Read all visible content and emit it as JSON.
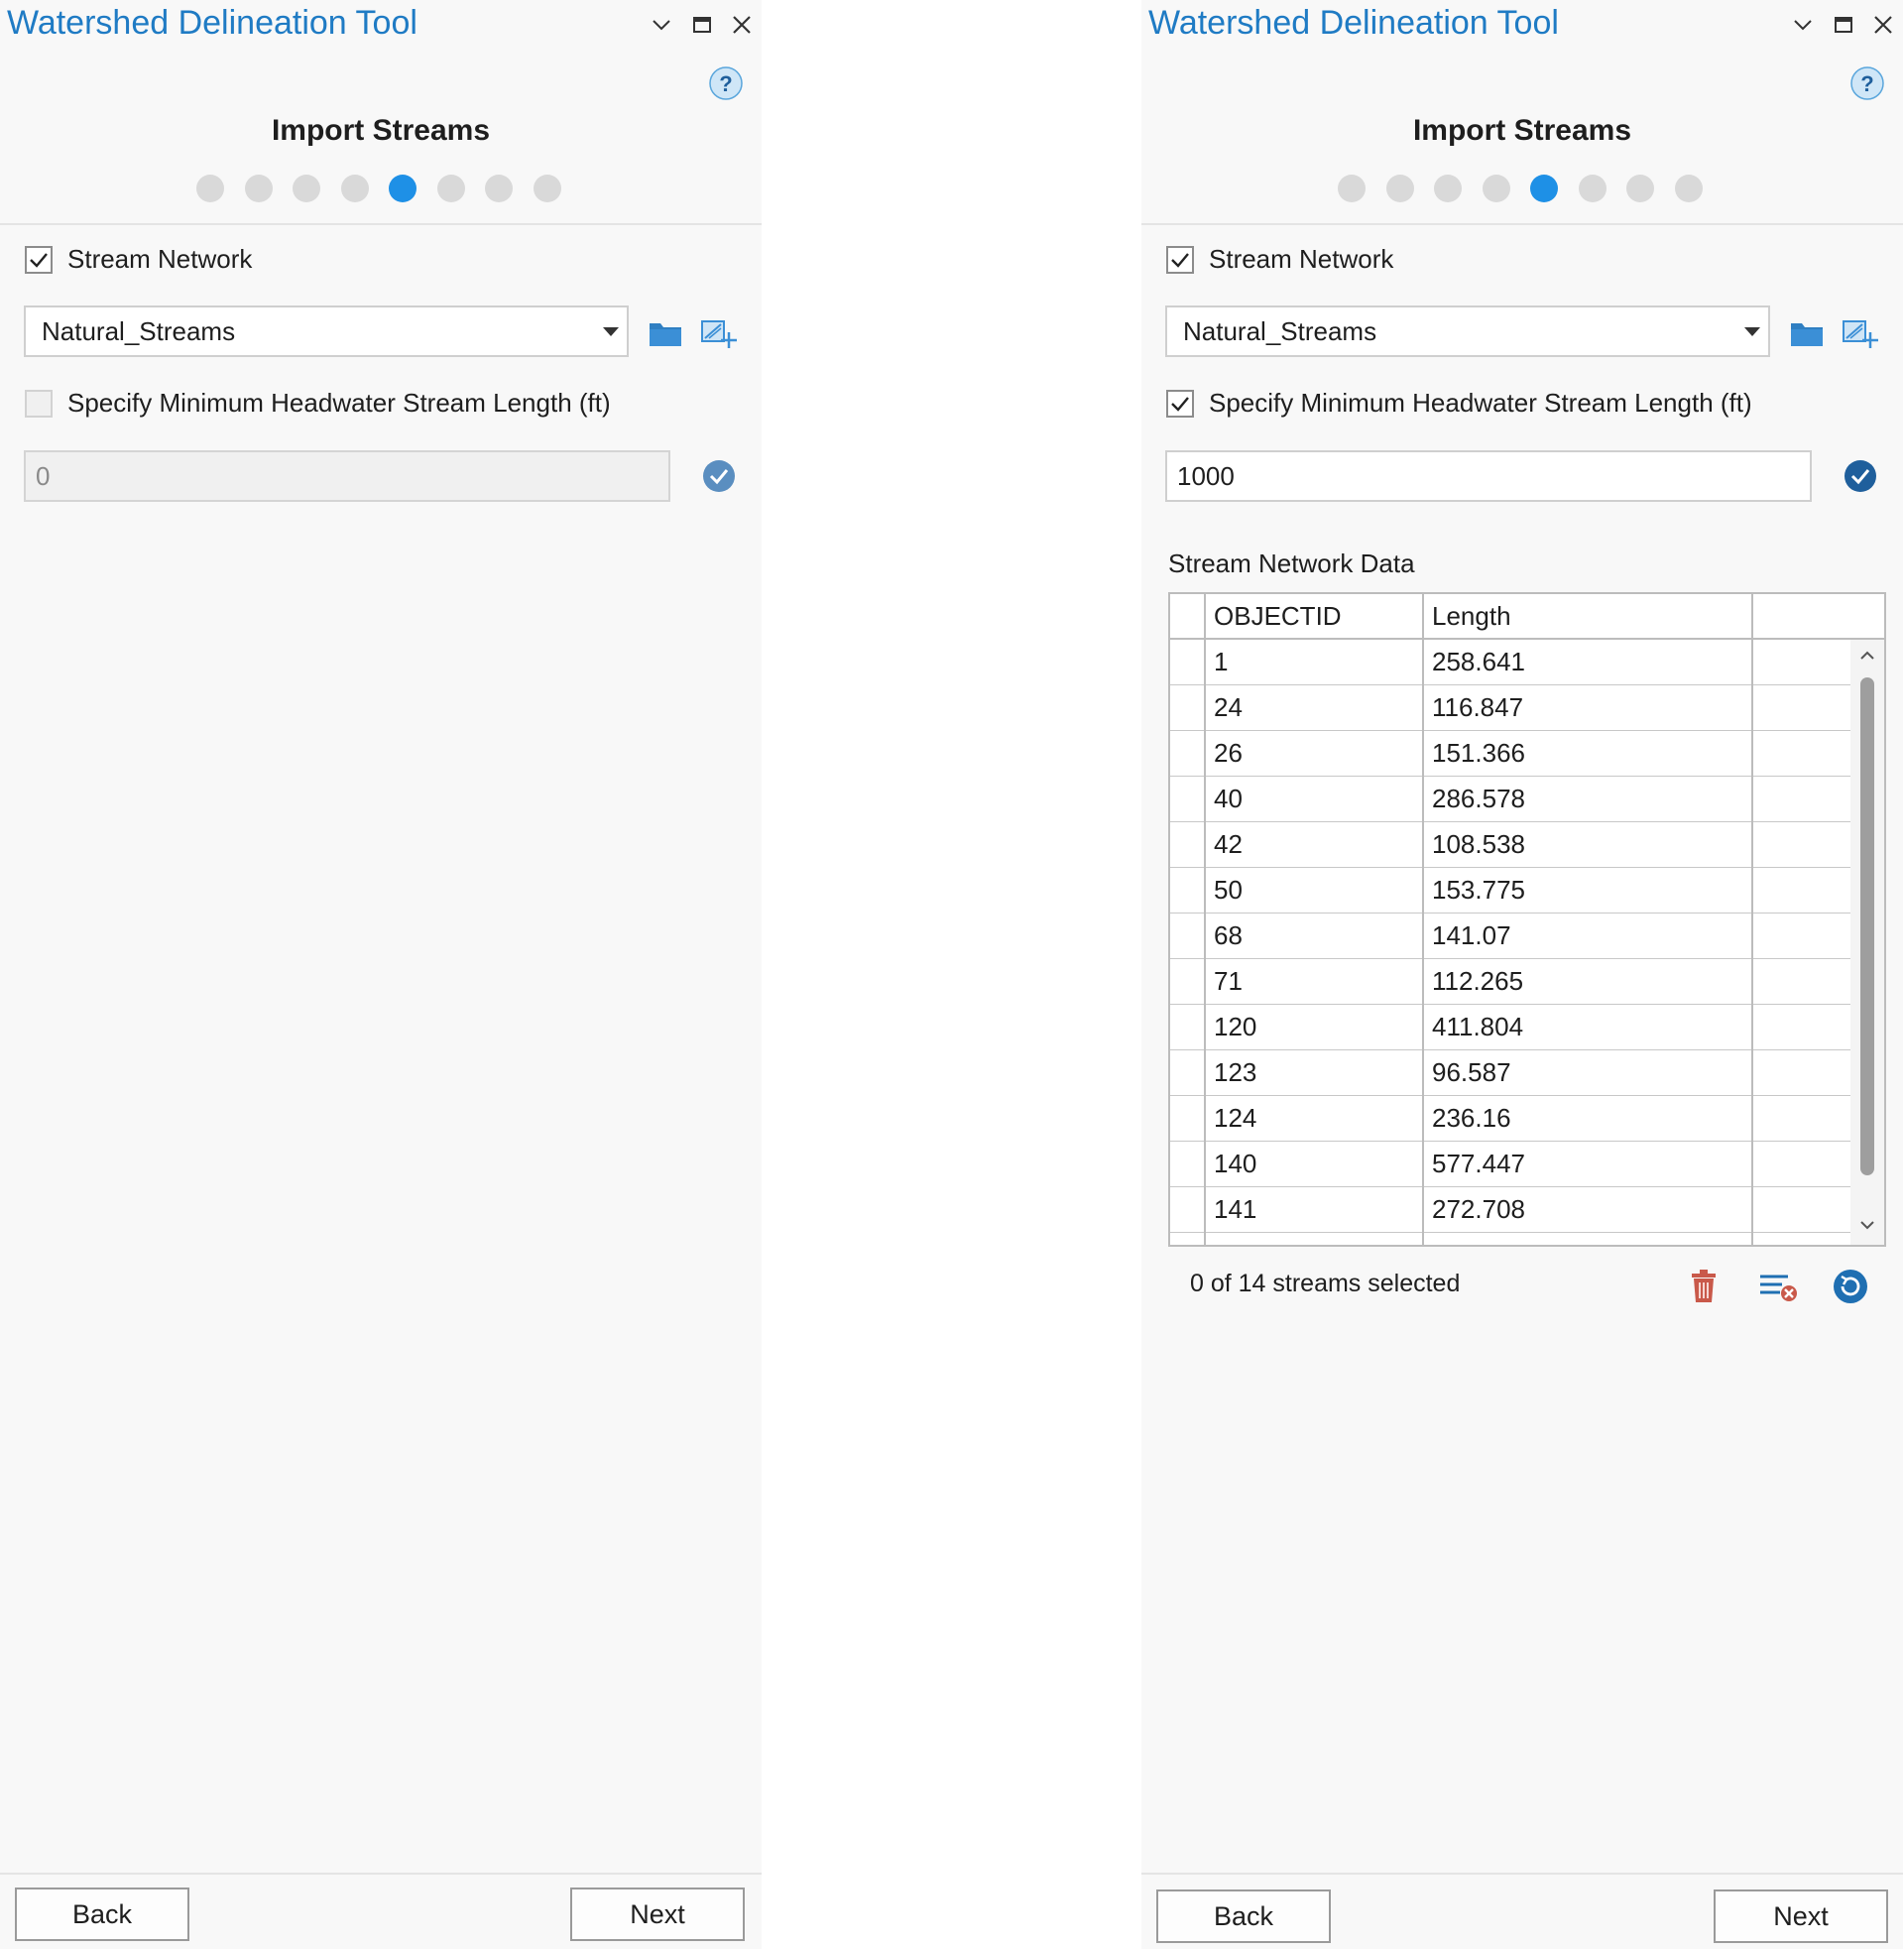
{
  "panels": [
    {
      "title": "Watershed Delineation Tool",
      "step_title": "Import Streams",
      "steps_total": 8,
      "active_step": 5,
      "stream_network": {
        "label": "Stream Network",
        "checked": true
      },
      "layer_select": {
        "value": "Natural_Streams"
      },
      "min_length": {
        "label": "Specify Minimum Headwater Stream Length (ft)",
        "checked": false,
        "value": "0",
        "enabled": false
      },
      "buttons": {
        "back": "Back",
        "next": "Next"
      }
    },
    {
      "title": "Watershed Delineation Tool",
      "step_title": "Import Streams",
      "steps_total": 8,
      "active_step": 5,
      "stream_network": {
        "label": "Stream Network",
        "checked": true
      },
      "layer_select": {
        "value": "Natural_Streams"
      },
      "min_length": {
        "label": "Specify Minimum Headwater Stream Length (ft)",
        "checked": true,
        "value": "1000",
        "enabled": true
      },
      "table": {
        "label": "Stream Network Data",
        "columns": [
          "OBJECTID",
          "Length"
        ],
        "rows": [
          [
            "1",
            "258.641"
          ],
          [
            "24",
            "116.847"
          ],
          [
            "26",
            "151.366"
          ],
          [
            "40",
            "286.578"
          ],
          [
            "42",
            "108.538"
          ],
          [
            "50",
            "153.775"
          ],
          [
            "68",
            "141.07"
          ],
          [
            "71",
            "112.265"
          ],
          [
            "120",
            "411.804"
          ],
          [
            "123",
            "96.587"
          ],
          [
            "124",
            "236.16"
          ],
          [
            "140",
            "577.447"
          ],
          [
            "141",
            "272.708"
          ]
        ]
      },
      "selection_status": "0 of 14 streams selected",
      "buttons": {
        "back": "Back",
        "next": "Next"
      }
    }
  ],
  "colors": {
    "title": "#1f7bc4",
    "active_step": "#1e90e6",
    "inactive_step": "#d9d9d9",
    "delete_icon": "#c9594a",
    "accent_icon": "#1f6fb2"
  },
  "icons": [
    "chevron-down-icon",
    "maximize-icon",
    "close-icon",
    "help-icon",
    "folder-icon",
    "add-feature-icon",
    "check-circle-icon",
    "trash-icon",
    "clear-selection-icon",
    "refresh-icon"
  ]
}
